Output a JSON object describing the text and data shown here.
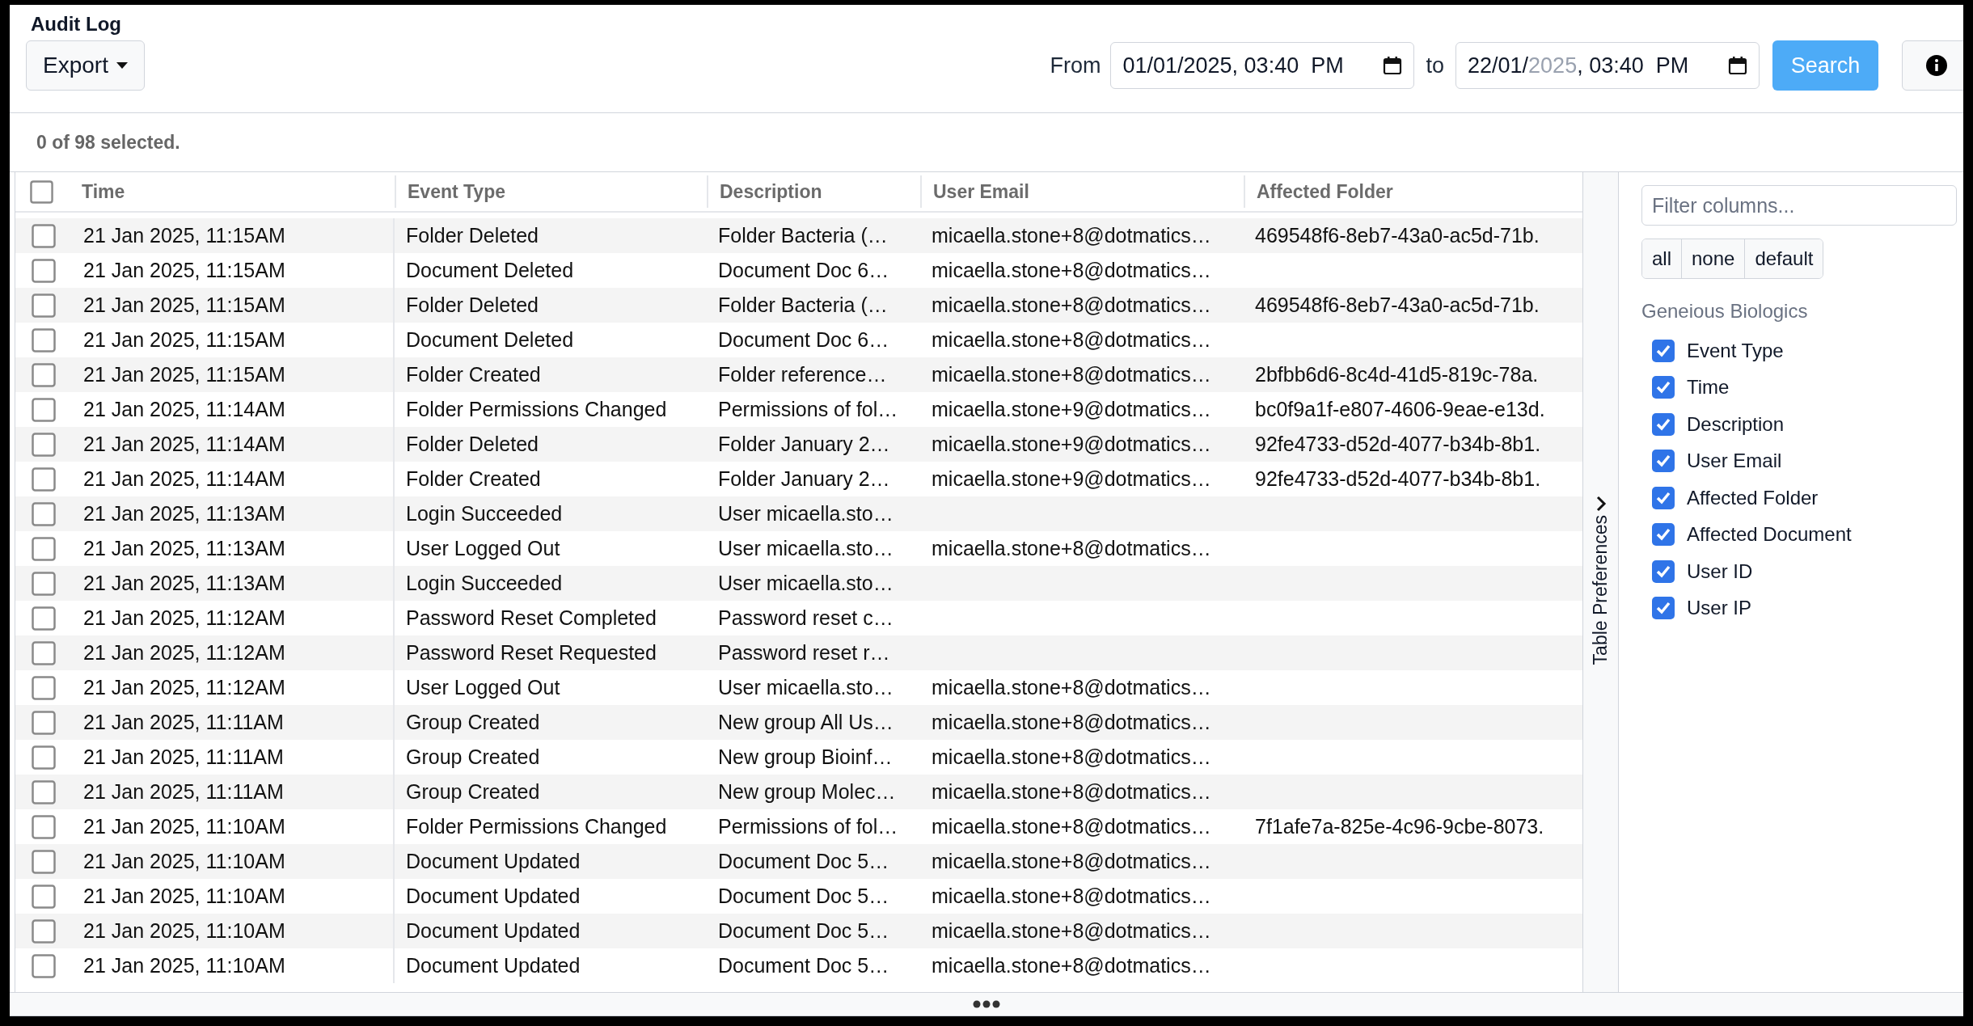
{
  "page": {
    "title": "Audit Log"
  },
  "toolbar": {
    "export_button": "Export",
    "from_label": "From",
    "from_date": [
      {
        "text": "01/01/2025, 03:40  PM",
        "highlighted": false
      }
    ],
    "to_label": "to",
    "to_date": [
      {
        "text": "22/01/",
        "highlighted": false
      },
      {
        "text": "2025",
        "highlighted": true
      },
      {
        "text": ", 03:40  PM",
        "highlighted": false
      }
    ],
    "search_button": "Search"
  },
  "selection_summary": "0 of 98 selected.",
  "table": {
    "select_all_checked": false,
    "columns": [
      "Time",
      "Event Type",
      "Description",
      "User Email",
      "Affected Folder"
    ],
    "rows": [
      {
        "time": "21 Jan 2025, 11:15AM",
        "event_type": "Folder Deleted",
        "description": "Folder Bacteria (…",
        "user_email": "micaella.stone+8@dotmatics…",
        "affected_folder": "469548f6-8eb7-43a0-ac5d-71b.",
        "selected": false
      },
      {
        "time": "21 Jan 2025, 11:15AM",
        "event_type": "Document Deleted",
        "description": "Document Doc 6…",
        "user_email": "micaella.stone+8@dotmatics…",
        "selected": false
      },
      {
        "time": "21 Jan 2025, 11:15AM",
        "event_type": "Folder Deleted",
        "description": "Folder Bacteria (…",
        "user_email": "micaella.stone+8@dotmatics…",
        "affected_folder": "469548f6-8eb7-43a0-ac5d-71b.",
        "selected": false
      },
      {
        "time": "21 Jan 2025, 11:15AM",
        "event_type": "Document Deleted",
        "description": "Document Doc 6…",
        "user_email": "micaella.stone+8@dotmatics…",
        "selected": false
      },
      {
        "time": "21 Jan 2025, 11:15AM",
        "event_type": "Folder Created",
        "description": "Folder reference…",
        "user_email": "micaella.stone+8@dotmatics…",
        "affected_folder": "2bfbb6d6-8c4d-41d5-819c-78a.",
        "selected": false
      },
      {
        "time": "21 Jan 2025, 11:14AM",
        "event_type": "Folder Permissions Changed",
        "description": "Permissions of fol…",
        "user_email": "micaella.stone+9@dotmatics…",
        "affected_folder": "bc0f9a1f-e807-4606-9eae-e13d.",
        "selected": false
      },
      {
        "time": "21 Jan 2025, 11:14AM",
        "event_type": "Folder Deleted",
        "description": "Folder January 2…",
        "user_email": "micaella.stone+9@dotmatics…",
        "affected_folder": "92fe4733-d52d-4077-b34b-8b1.",
        "selected": false
      },
      {
        "time": "21 Jan 2025, 11:14AM",
        "event_type": "Folder Created",
        "description": "Folder January 2…",
        "user_email": "micaella.stone+9@dotmatics…",
        "affected_folder": "92fe4733-d52d-4077-b34b-8b1.",
        "selected": false
      },
      {
        "time": "21 Jan 2025, 11:13AM",
        "event_type": "Login Succeeded",
        "description": "User micaella.sto…",
        "selected": false
      },
      {
        "time": "21 Jan 2025, 11:13AM",
        "event_type": "User Logged Out",
        "description": "User micaella.sto…",
        "user_email": "micaella.stone+8@dotmatics…",
        "selected": false
      },
      {
        "time": "21 Jan 2025, 11:13AM",
        "event_type": "Login Succeeded",
        "description": "User micaella.sto…",
        "selected": false
      },
      {
        "time": "21 Jan 2025, 11:12AM",
        "event_type": "Password Reset Completed",
        "description": "Password reset c…",
        "selected": false
      },
      {
        "time": "21 Jan 2025, 11:12AM",
        "event_type": "Password Reset Requested",
        "description": "Password reset r…",
        "selected": false
      },
      {
        "time": "21 Jan 2025, 11:12AM",
        "event_type": "User Logged Out",
        "description": "User micaella.sto…",
        "user_email": "micaella.stone+8@dotmatics…",
        "selected": false
      },
      {
        "time": "21 Jan 2025, 11:11AM",
        "event_type": "Group Created",
        "description": "New group All Us…",
        "user_email": "micaella.stone+8@dotmatics…",
        "selected": false
      },
      {
        "time": "21 Jan 2025, 11:11AM",
        "event_type": "Group Created",
        "description": "New group Bioinf…",
        "user_email": "micaella.stone+8@dotmatics…",
        "selected": false
      },
      {
        "time": "21 Jan 2025, 11:11AM",
        "event_type": "Group Created",
        "description": "New group Molec…",
        "user_email": "micaella.stone+8@dotmatics…",
        "selected": false
      },
      {
        "time": "21 Jan 2025, 11:10AM",
        "event_type": "Folder Permissions Changed",
        "description": "Permissions of fol…",
        "user_email": "micaella.stone+8@dotmatics…",
        "affected_folder": "7f1afe7a-825e-4c96-9cbe-8073.",
        "selected": false
      },
      {
        "time": "21 Jan 2025, 11:10AM",
        "event_type": "Document Updated",
        "description": "Document Doc 5…",
        "user_email": "micaella.stone+8@dotmatics…",
        "selected": false
      },
      {
        "time": "21 Jan 2025, 11:10AM",
        "event_type": "Document Updated",
        "description": "Document Doc 5…",
        "user_email": "micaella.stone+8@dotmatics…",
        "selected": false
      },
      {
        "time": "21 Jan 2025, 11:10AM",
        "event_type": "Document Updated",
        "description": "Document Doc 5…",
        "user_email": "micaella.stone+8@dotmatics…",
        "selected": false
      },
      {
        "time": "21 Jan 2025, 11:10AM",
        "event_type": "Document Updated",
        "description": "Document Doc 5…",
        "user_email": "micaella.stone+8@dotmatics…",
        "selected": false
      }
    ]
  },
  "preferences_tab": "Table Preferences",
  "column_panel": {
    "filter_placeholder": "Filter columns...",
    "presets": [
      "all",
      "none",
      "default"
    ],
    "group_label": "Geneious Biologics",
    "columns": [
      {
        "label": "Event Type",
        "checked": true
      },
      {
        "label": "Time",
        "checked": true
      },
      {
        "label": "Description",
        "checked": true
      },
      {
        "label": "User Email",
        "checked": true
      },
      {
        "label": "Affected Folder",
        "checked": true
      },
      {
        "label": "Affected Document",
        "checked": true
      },
      {
        "label": "User ID",
        "checked": true
      },
      {
        "label": "User IP",
        "checked": true
      }
    ]
  }
}
